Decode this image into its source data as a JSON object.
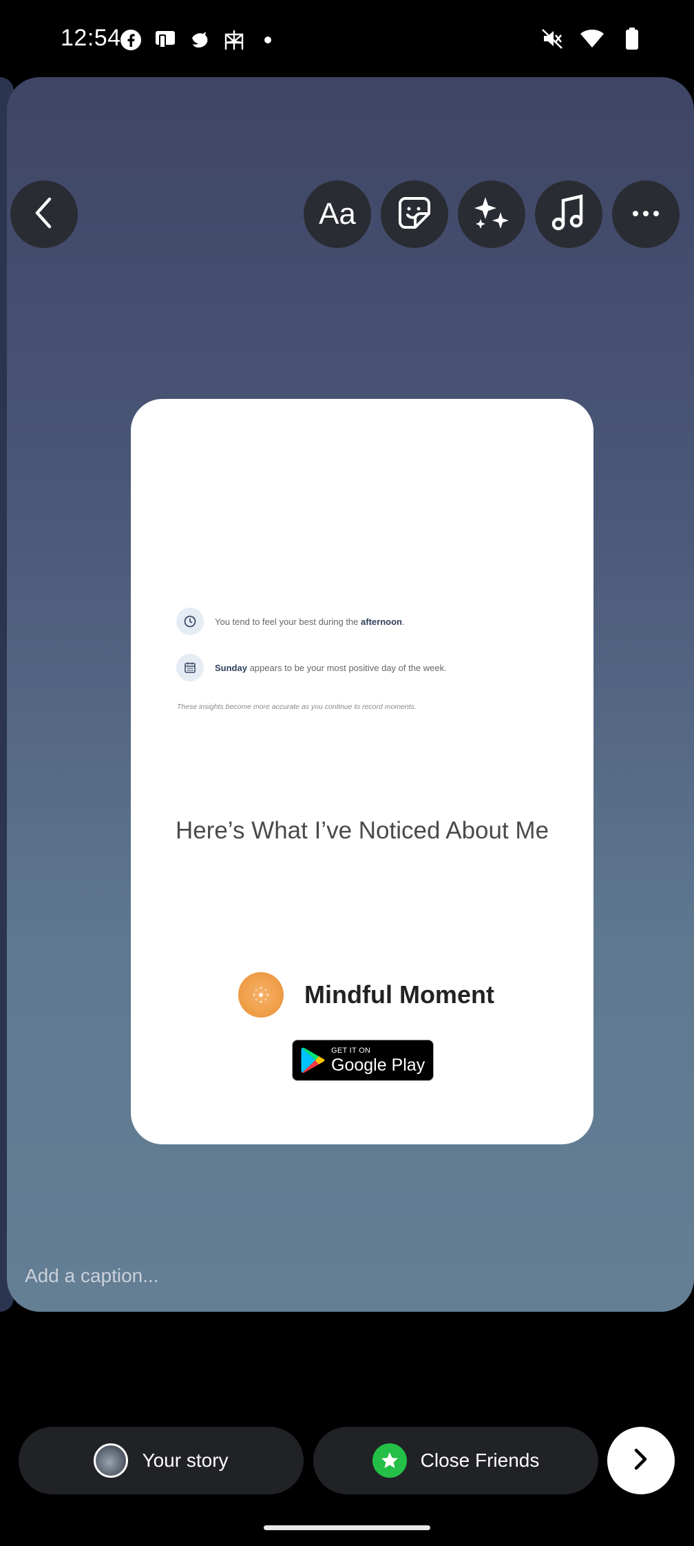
{
  "status_bar": {
    "time": "12:54",
    "left_icons": [
      "facebook-icon",
      "remote-app-icon",
      "bird-app-icon",
      "perplexity-icon",
      "notification-dot"
    ],
    "right_icons": [
      "muted-icon",
      "wifi-icon",
      "battery-icon"
    ]
  },
  "toolbar": {
    "back": "back-icon",
    "text_label": "Aa",
    "buttons": [
      "text-button",
      "sticker-button",
      "effects-button",
      "music-button",
      "more-button"
    ]
  },
  "card": {
    "insights": [
      {
        "prefix": "You tend to feel your best during the ",
        "bold": "afternoon",
        "suffix": "."
      },
      {
        "prefix": "",
        "bold": "Sunday",
        "suffix": " appears to be your most positive day of the week."
      }
    ],
    "note": "These insights become more accurate as you continue to record moments.",
    "headline": "Here’s What I’ve Noticed About Me",
    "brand_name": "Mindful Moment",
    "store_badge": {
      "small": "GET IT ON",
      "big": "Google Play"
    }
  },
  "caption_placeholder": "Add a caption...",
  "bottom_bar": {
    "your_story_label": "Your story",
    "close_friends_label": "Close Friends"
  },
  "colors": {
    "close_friends_green": "#23bf46",
    "brand_orange": "#f0a04b",
    "canvas_top": "#3f4565",
    "canvas_bottom": "#647f94"
  }
}
